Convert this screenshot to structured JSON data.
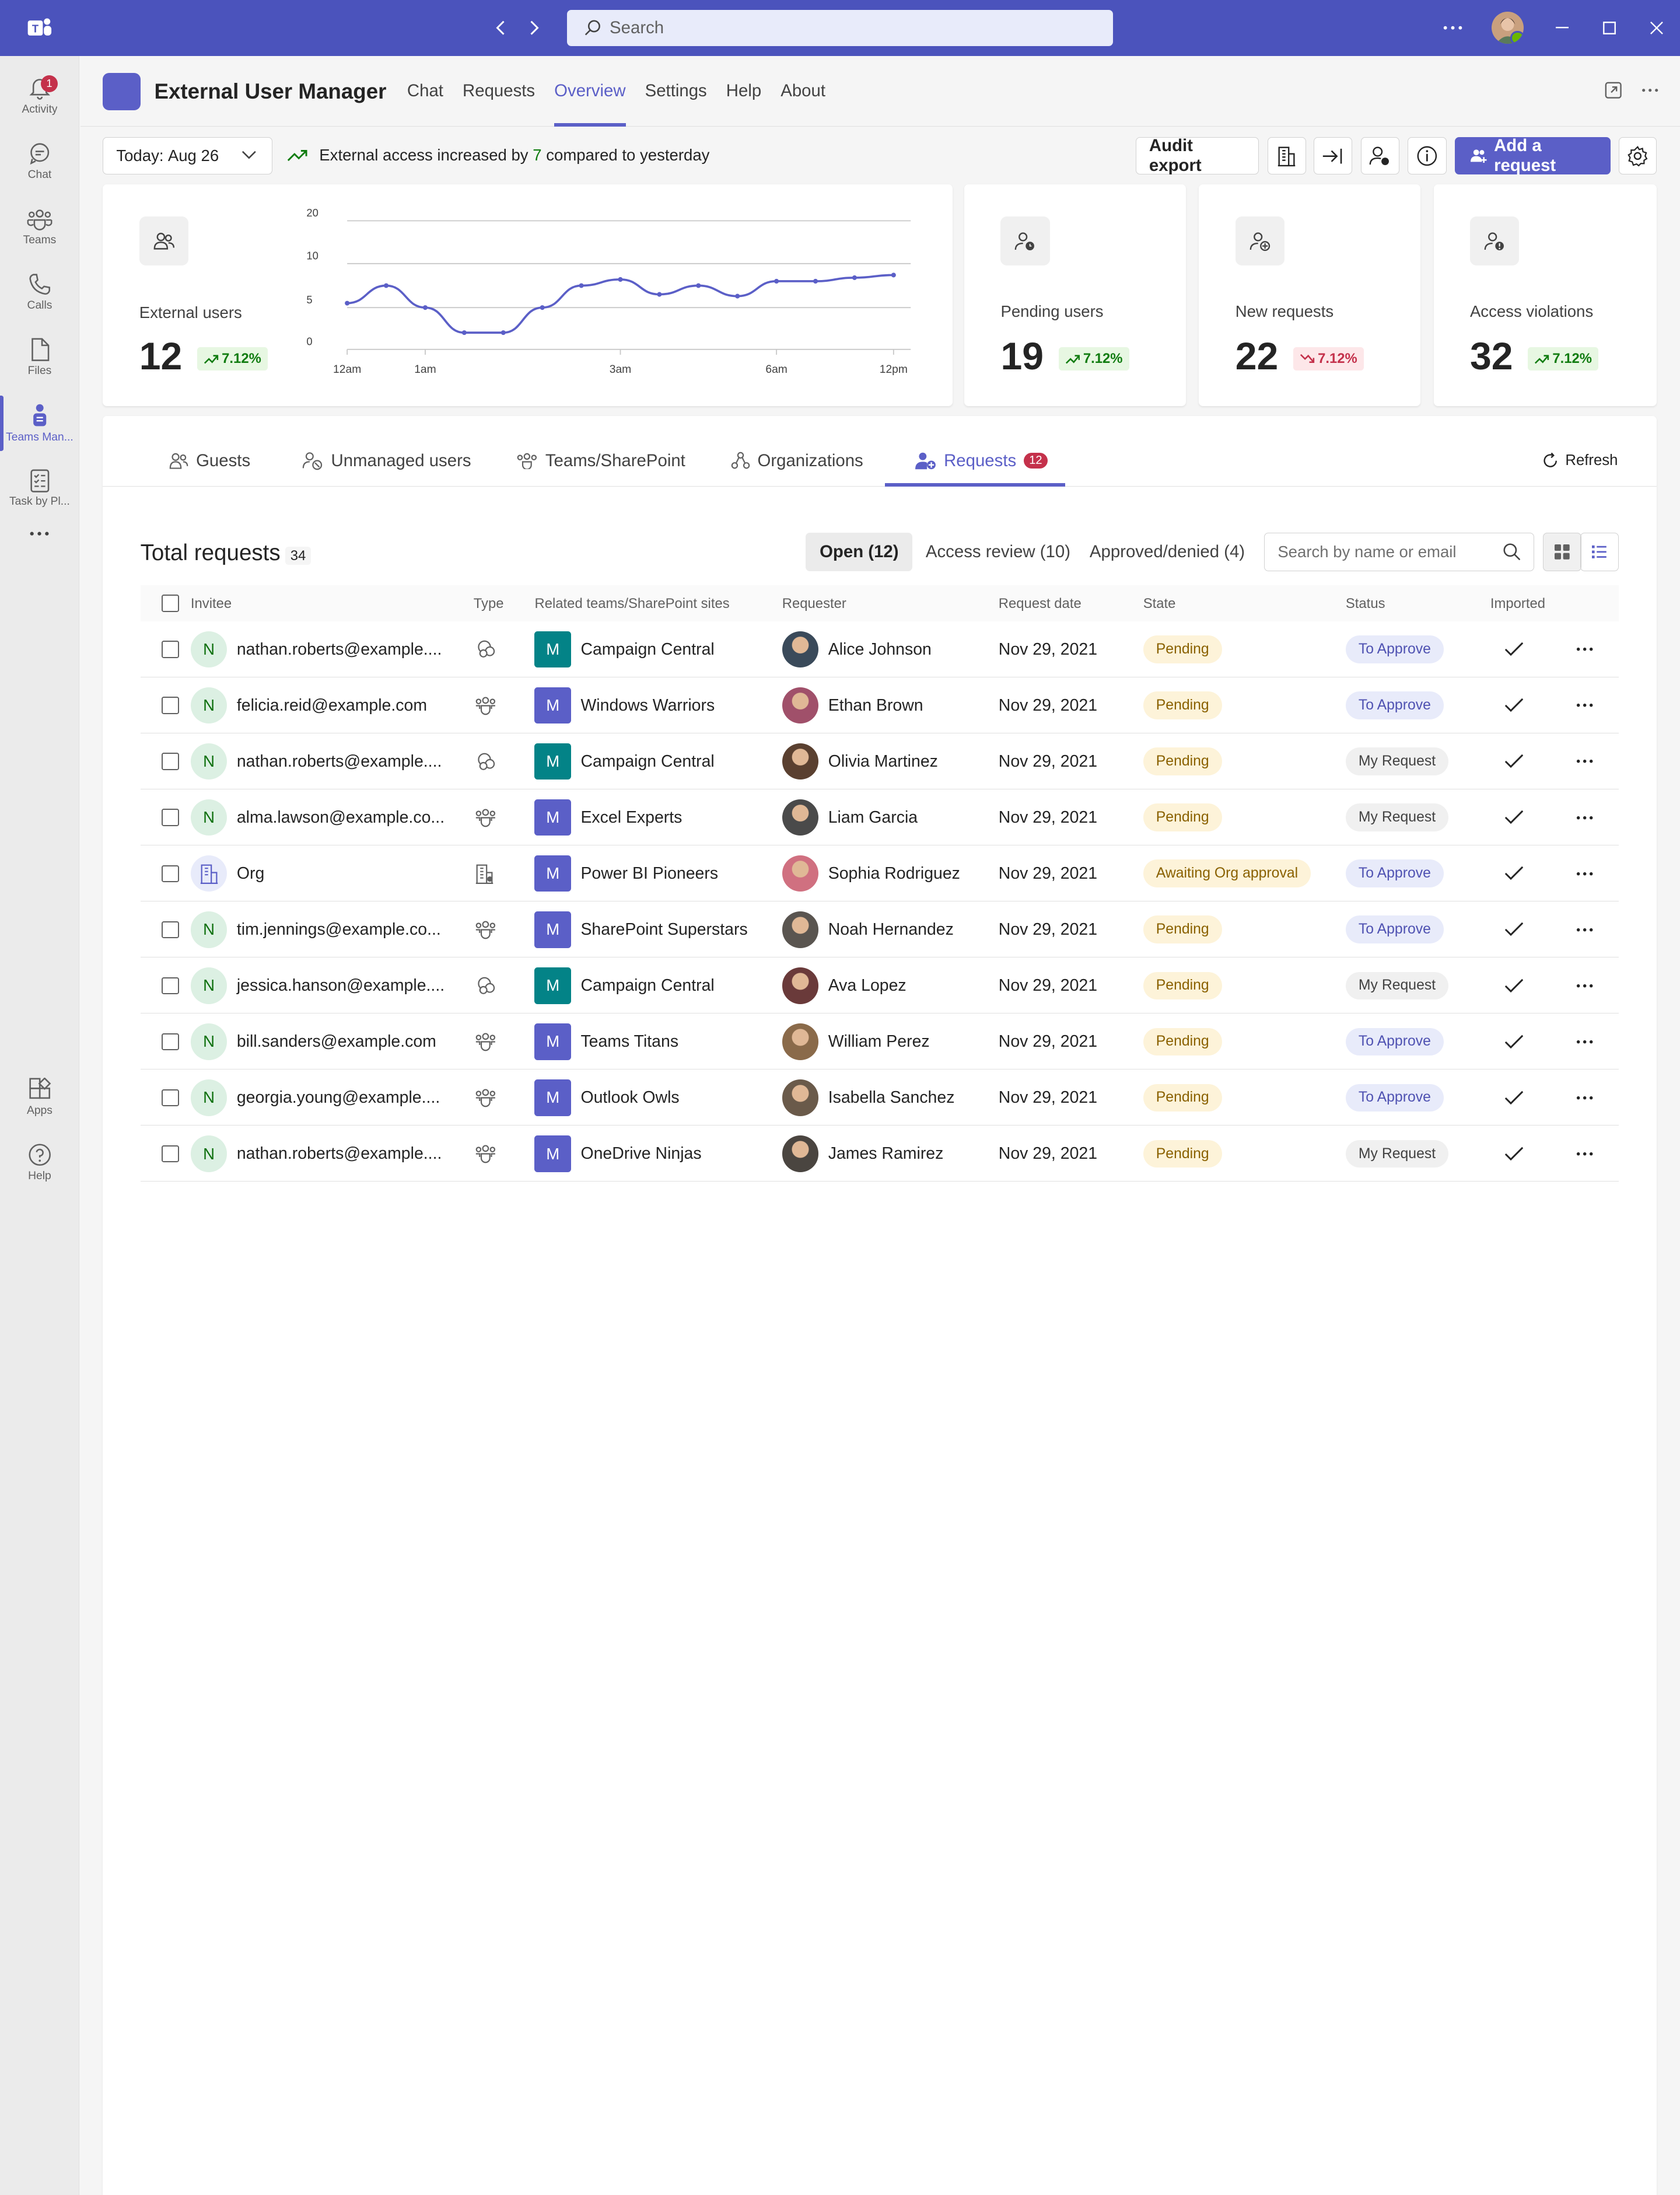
{
  "window": {
    "search_placeholder": "Search"
  },
  "rail": [
    {
      "label": "Activity",
      "icon": "bell-icon",
      "badge": "1"
    },
    {
      "label": "Chat",
      "icon": "chat-icon"
    },
    {
      "label": "Teams",
      "icon": "teams-icon"
    },
    {
      "label": "Calls",
      "icon": "phone-icon"
    },
    {
      "label": "Files",
      "icon": "file-icon"
    },
    {
      "label": "Teams Man...",
      "icon": "teams-manager-icon",
      "active": true
    },
    {
      "label": "Task by Pl...",
      "icon": "checklist-icon"
    },
    {
      "label": "Apps",
      "icon": "apps-icon"
    },
    {
      "label": "Help",
      "icon": "help-icon"
    }
  ],
  "app": {
    "title": "External User Manager",
    "tabs": [
      "Chat",
      "Requests",
      "Overview",
      "Settings",
      "Help",
      "About"
    ],
    "active_tab": "Overview",
    "accent": "#5b5fc7"
  },
  "toolbar": {
    "date_prefix": "Today:",
    "date_value": "Aug 26",
    "trend_before": "External access increased by",
    "trend_number": "7",
    "trend_after": "compared to yesterday",
    "audit_label": "Audit export",
    "add_label": "Add a request"
  },
  "kpis": {
    "external": {
      "label": "External users",
      "value": "12",
      "change": "7.12%",
      "direction": "up"
    },
    "pending": {
      "label": "Pending users",
      "value": "19",
      "change": "7.12%",
      "direction": "up"
    },
    "new": {
      "label": "New requests",
      "value": "22",
      "change": "7.12%",
      "direction": "down"
    },
    "violations": {
      "label": "Access violations",
      "value": "32",
      "change": "7.12%",
      "direction": "up"
    }
  },
  "chart_data": {
    "type": "line",
    "x": [
      "12am",
      "",
      "1am",
      "",
      "",
      "",
      "",
      "3am",
      "",
      "",
      "",
      "6am",
      "",
      "",
      "12pm"
    ],
    "y_ticks": [
      "20",
      "10",
      "5",
      "0"
    ],
    "values": [
      5.5,
      7.5,
      5,
      2,
      2,
      5,
      7.5,
      8.2,
      6.5,
      7.5,
      6.3,
      8,
      8,
      8.4,
      8.7
    ],
    "x_tick_labels": [
      "12am",
      "1am",
      "3am",
      "6am",
      "12pm"
    ],
    "grid": true
  },
  "panel": {
    "tabs": [
      {
        "label": "Guests",
        "icon": "guests-icon"
      },
      {
        "label": "Unmanaged users",
        "icon": "unmanaged-users-icon"
      },
      {
        "label": "Teams/SharePoint",
        "icon": "teams-sharepoint-icon"
      },
      {
        "label": "Organizations",
        "icon": "organizations-icon"
      },
      {
        "label": "Requests",
        "icon": "requests-icon",
        "badge": "12",
        "active": true
      }
    ],
    "refresh": "Refresh",
    "total_title": "Total requests",
    "total_count": "34",
    "filters": [
      "Open (12)",
      "Access review (10)",
      "Approved/denied (4)"
    ],
    "search_placeholder": "Search by name or email",
    "columns": [
      "Invitee",
      "Type",
      "Related teams/SharePoint sites",
      "Requester",
      "Request date",
      "State",
      "Status",
      "Imported"
    ],
    "rows": [
      {
        "initial": "N",
        "invitee": "nathan.roberts@example....",
        "type": "sharepoint",
        "team_initial": "M",
        "team_color": "#038387",
        "team": "Campaign Central",
        "requester": "Alice Johnson",
        "avatar": "#3a4a5a",
        "date": "Nov 29, 2021",
        "state": "Pending",
        "status": "To Approve"
      },
      {
        "initial": "N",
        "invitee": "felicia.reid@example.com",
        "type": "teams",
        "team_initial": "M",
        "team_color": "#5b5fc7",
        "team": "Windows Warriors",
        "requester": "Ethan Brown",
        "avatar": "#a0506a",
        "date": "Nov 29, 2021",
        "state": "Pending",
        "status": "To Approve"
      },
      {
        "initial": "N",
        "invitee": "nathan.roberts@example....",
        "type": "sharepoint",
        "team_initial": "M",
        "team_color": "#038387",
        "team": "Campaign Central",
        "requester": "Olivia Martinez",
        "avatar": "#5a4030",
        "date": "Nov 29, 2021",
        "state": "Pending",
        "status": "My Request"
      },
      {
        "initial": "N",
        "invitee": "alma.lawson@example.co...",
        "type": "teams",
        "team_initial": "M",
        "team_color": "#5b5fc7",
        "team": "Excel Experts",
        "requester": "Liam Garcia",
        "avatar": "#4a4a4a",
        "date": "Nov 29, 2021",
        "state": "Pending",
        "status": "My Request"
      },
      {
        "initial": "",
        "invitee": "Org",
        "type": "org",
        "team_initial": "M",
        "team_color": "#5b5fc7",
        "team": "Power BI Pioneers",
        "requester": "Sophia Rodriguez",
        "avatar": "#d07080",
        "date": "Nov 29, 2021",
        "state": "Awaiting Org approval",
        "status": "To Approve"
      },
      {
        "initial": "N",
        "invitee": "tim.jennings@example.co...",
        "type": "teams",
        "team_initial": "M",
        "team_color": "#5b5fc7",
        "team": "SharePoint Superstars",
        "requester": "Noah Hernandez",
        "avatar": "#5a5550",
        "date": "Nov 29, 2021",
        "state": "Pending",
        "status": "To Approve"
      },
      {
        "initial": "N",
        "invitee": "jessica.hanson@example....",
        "type": "sharepoint",
        "team_initial": "M",
        "team_color": "#038387",
        "team": "Campaign Central",
        "requester": "Ava Lopez",
        "avatar": "#6a3a3a",
        "date": "Nov 29, 2021",
        "state": "Pending",
        "status": "My Request"
      },
      {
        "initial": "N",
        "invitee": "bill.sanders@example.com",
        "type": "teams",
        "team_initial": "M",
        "team_color": "#5b5fc7",
        "team": "Teams Titans",
        "requester": "William Perez",
        "avatar": "#8a6a4a",
        "date": "Nov 29, 2021",
        "state": "Pending",
        "status": "To Approve"
      },
      {
        "initial": "N",
        "invitee": "georgia.young@example....",
        "type": "teams",
        "team_initial": "M",
        "team_color": "#5b5fc7",
        "team": "Outlook Owls",
        "requester": "Isabella Sanchez",
        "avatar": "#6a5a4a",
        "date": "Nov 29, 2021",
        "state": "Pending",
        "status": "To Approve"
      },
      {
        "initial": "N",
        "invitee": "nathan.roberts@example....",
        "type": "teams",
        "team_initial": "M",
        "team_color": "#5b5fc7",
        "team": "OneDrive Ninjas",
        "requester": "James Ramirez",
        "avatar": "#4a4540",
        "date": "Nov 29, 2021",
        "state": "Pending",
        "status": "My Request"
      }
    ]
  }
}
